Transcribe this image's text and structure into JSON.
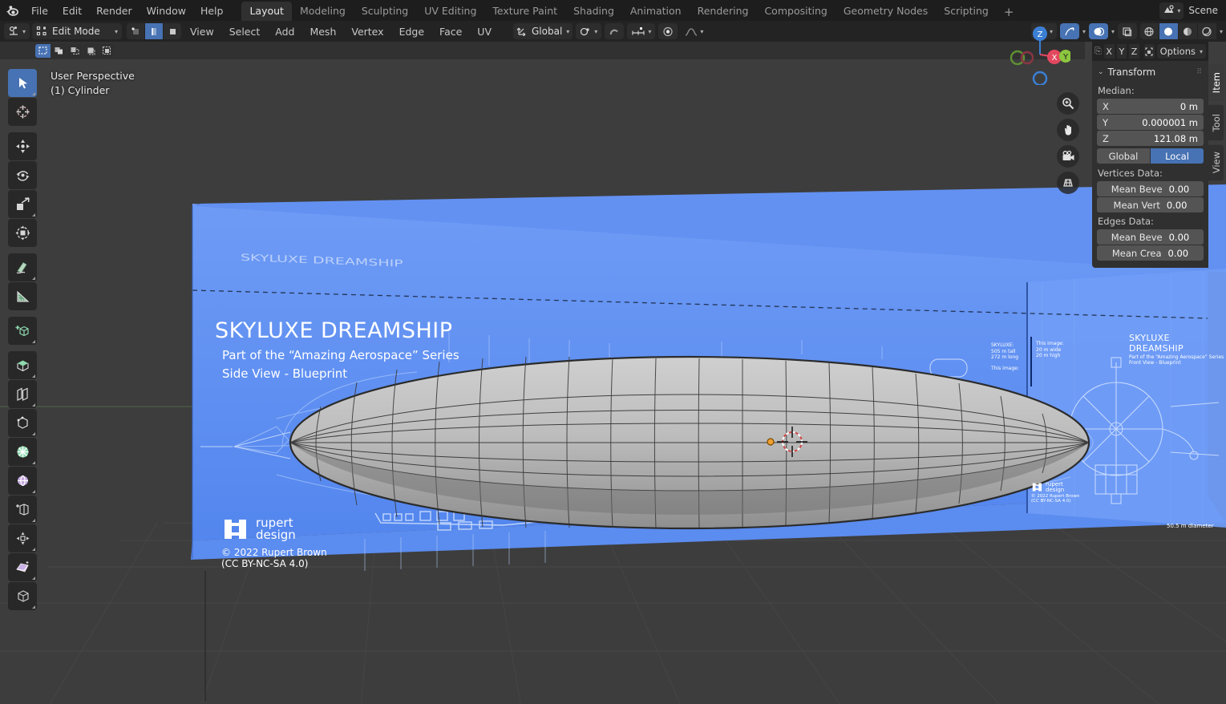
{
  "app": {
    "logo_icon": "blender-logo-icon",
    "menus": [
      "File",
      "Edit",
      "Render",
      "Window",
      "Help"
    ],
    "workspace_tabs": [
      {
        "label": "Layout",
        "active": true
      },
      {
        "label": "Modeling",
        "active": false
      },
      {
        "label": "Sculpting",
        "active": false
      },
      {
        "label": "UV Editing",
        "active": false
      },
      {
        "label": "Texture Paint",
        "active": false
      },
      {
        "label": "Shading",
        "active": false
      },
      {
        "label": "Animation",
        "active": false
      },
      {
        "label": "Rendering",
        "active": false
      },
      {
        "label": "Compositing",
        "active": false
      },
      {
        "label": "Geometry Nodes",
        "active": false
      },
      {
        "label": "Scripting",
        "active": false
      }
    ],
    "add_workspace_label": "+",
    "scene_name": "Scene",
    "scene_icon": "scene-data-icon"
  },
  "viewport_header": {
    "editor_type_icon": "editor-type-icon",
    "mode": "Edit Mode",
    "select_modes": [
      {
        "name": "vertex-select-mode",
        "active": false
      },
      {
        "name": "edge-select-mode",
        "active": true
      },
      {
        "name": "face-select-mode",
        "active": false
      }
    ],
    "menus": [
      "View",
      "Select",
      "Add",
      "Mesh",
      "Vertex",
      "Edge",
      "Face",
      "UV"
    ],
    "transform_orientation": "Global",
    "orientation_icon": "orientation-gizmo-icon",
    "snap_icon": "magnet-icon",
    "snap_target_icon": "snap-increment-icon",
    "proportional_icon": "proportional-editing-icon",
    "falloff_icon": "smooth-falloff-icon",
    "right_icons": [
      "visibility-icon",
      "gizmo-icon",
      "overlays-icon",
      "xray-icon"
    ],
    "shading_modes": [
      {
        "name": "wireframe-shading",
        "active": false
      },
      {
        "name": "solid-shading",
        "active": true
      },
      {
        "name": "material-preview-shading",
        "active": false
      },
      {
        "name": "rendered-shading",
        "active": false
      }
    ]
  },
  "tool_settings": {
    "select_tools": [
      {
        "name": "select-set",
        "active": true
      },
      {
        "name": "select-extend",
        "active": false
      },
      {
        "name": "select-subtract",
        "active": false
      },
      {
        "name": "select-invert",
        "active": false
      },
      {
        "name": "select-intersect",
        "active": false
      }
    ]
  },
  "viewport": {
    "view_name": "User Perspective",
    "object_name": "(1) Cylinder",
    "background_color": "#3d3d3d",
    "blueprint_color": "#5b8ef0",
    "mesh_color": "#b4b4b4",
    "cursor_icon": "3d-cursor-icon",
    "origin_icon": "object-origin-icon"
  },
  "toolbar": {
    "tools": [
      {
        "name": "tweak-tool",
        "icon": "cursor-arrow-icon",
        "active": true,
        "has_submenu": true
      },
      {
        "name": "cursor-tool",
        "icon": "3d-cursor-icon",
        "active": false,
        "has_submenu": false
      },
      {
        "name": "move-tool",
        "icon": "move-arrows-icon",
        "active": false,
        "has_submenu": false,
        "gap": true
      },
      {
        "name": "rotate-tool",
        "icon": "rotate-icon",
        "active": false,
        "has_submenu": false
      },
      {
        "name": "scale-tool",
        "icon": "scale-icon",
        "active": false,
        "has_submenu": true
      },
      {
        "name": "transform-tool",
        "icon": "transform-icon",
        "active": false,
        "has_submenu": false
      },
      {
        "name": "annotate-tool",
        "icon": "pencil-icon",
        "active": false,
        "has_submenu": true,
        "gap": true
      },
      {
        "name": "measure-tool",
        "icon": "ruler-icon",
        "active": false,
        "has_submenu": false
      },
      {
        "name": "add-cube-tool",
        "icon": "add-cube-icon",
        "active": false,
        "has_submenu": true,
        "gap": true
      },
      {
        "name": "extrude-region-tool",
        "icon": "extrude-icon",
        "active": false,
        "has_submenu": true,
        "gap": true
      },
      {
        "name": "inset-faces-tool",
        "icon": "inset-faces-icon",
        "active": false,
        "has_submenu": false
      },
      {
        "name": "bevel-tool",
        "icon": "bevel-icon",
        "active": false,
        "has_submenu": true
      },
      {
        "name": "loop-cut-tool",
        "icon": "loop-cut-icon",
        "active": false,
        "has_submenu": true
      },
      {
        "name": "knife-tool",
        "icon": "knife-icon",
        "active": false,
        "has_submenu": false
      },
      {
        "name": "poly-build-tool",
        "icon": "poly-build-icon",
        "active": false,
        "has_submenu": false
      },
      {
        "name": "spin-tool",
        "icon": "spin-icon",
        "active": false,
        "has_submenu": true
      },
      {
        "name": "smooth-tool",
        "icon": "smooth-vertex-icon",
        "active": false,
        "has_submenu": true
      },
      {
        "name": "edge-slide-tool",
        "icon": "edge-slide-icon",
        "active": false,
        "has_submenu": true
      },
      {
        "name": "shrink-fatten-tool",
        "icon": "shrink-fatten-icon",
        "active": false,
        "has_submenu": true
      },
      {
        "name": "shear-tool",
        "icon": "shear-icon",
        "active": false,
        "has_submenu": true
      },
      {
        "name": "rip-region-tool",
        "icon": "rip-region-icon",
        "active": false,
        "has_submenu": true
      }
    ]
  },
  "nav_gizmo": {
    "axes": [
      {
        "label": "Z",
        "color": "#3b7fd4"
      },
      {
        "label": "X",
        "color": "#e2485f"
      },
      {
        "label": "Y",
        "color": "#8dc63f"
      }
    ],
    "buttons": [
      {
        "name": "zoom-view-button",
        "icon": "magnifier-plus-icon"
      },
      {
        "name": "pan-view-button",
        "icon": "hand-icon"
      },
      {
        "name": "camera-view-button",
        "icon": "camera-icon"
      },
      {
        "name": "toggle-perspective-button",
        "icon": "grid-perspective-icon"
      }
    ]
  },
  "sidebar": {
    "axis_buttons": [
      "X",
      "Y",
      "Z"
    ],
    "lock_icon": "lock-icon",
    "gizmo_icon": "transform-gizmo-icon",
    "options_label": "Options",
    "tabs": [
      {
        "label": "Item",
        "active": true
      },
      {
        "label": "Tool",
        "active": false
      },
      {
        "label": "View",
        "active": false
      }
    ],
    "panel": {
      "title": "Transform",
      "collapse_icon": "chevron-down-icon",
      "grip_icon": "drag-grip-icon",
      "median_label": "Median:",
      "median_fields": [
        {
          "name": "X",
          "value": "0 m"
        },
        {
          "name": "Y",
          "value": "0.000001 m"
        },
        {
          "name": "Z",
          "value": "121.08 m"
        }
      ],
      "space_toggle": [
        {
          "label": "Global",
          "active": false
        },
        {
          "label": "Local",
          "active": true
        }
      ],
      "vertices_label": "Vertices Data:",
      "vertices_fields": [
        {
          "name": "Mean Beve",
          "value": "0.00"
        },
        {
          "name": "Mean Vert",
          "value": "0.00"
        }
      ],
      "edges_label": "Edges Data:",
      "edges_fields": [
        {
          "name": "Mean Beve",
          "value": "0.00"
        },
        {
          "name": "Mean Crea",
          "value": "0.00"
        }
      ]
    }
  },
  "blueprint": {
    "title": "SKYLUXE DREAMSHIP",
    "subtitle": "Part of the “Amazing Aerospace” Series",
    "view_label": "Side View - Blueprint",
    "brand_name_1": "rupert",
    "brand_name_2": "design",
    "copyright": "© 2022 Rupert Brown",
    "license": "(CC BY-NC-SA 4.0)",
    "spec_label": "SKYLUXE:",
    "spec_lines": [
      "505 m tall",
      "272 m long",
      "This image:"
    ],
    "image_spec_lines": [
      "This image:",
      "20 m wide",
      "20 m high"
    ],
    "right_title": "SKYLUXE DREAMSHIP",
    "right_subtitle": "Part of the “Amazing Aerospace” Series",
    "right_view_label": "Front View - Blueprint",
    "diameter_label": "50.5 m diameter",
    "ceiling_title": "SKYLUXE DREAMSHIP"
  }
}
